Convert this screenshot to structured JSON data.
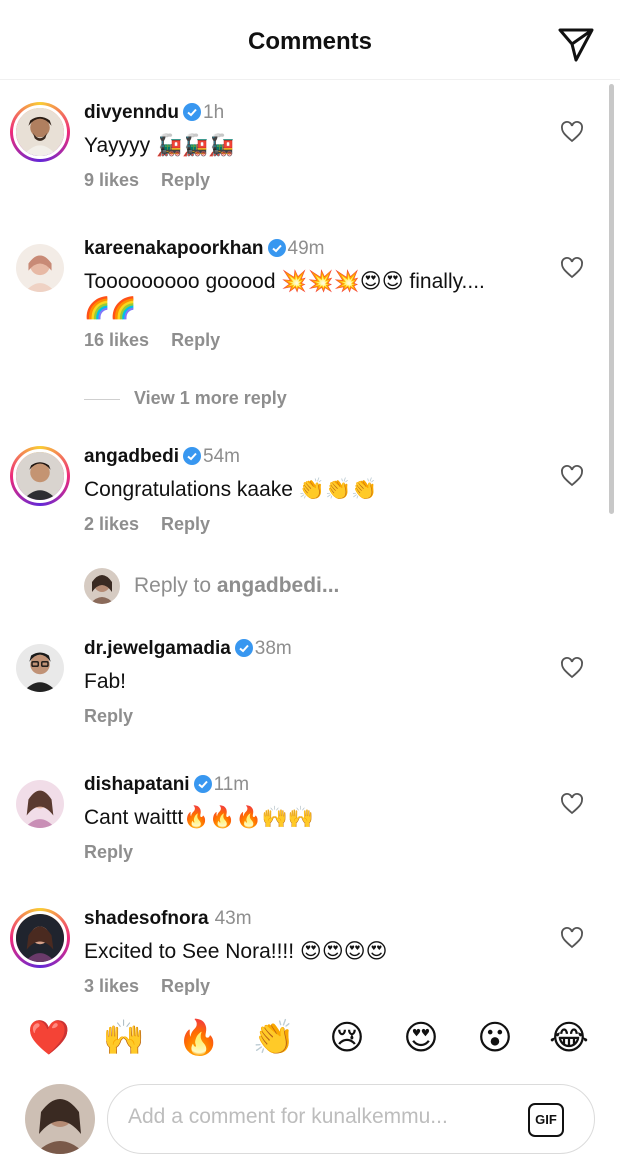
{
  "header": {
    "title": "Comments",
    "send_icon": "paper-plane-icon"
  },
  "comments": [
    {
      "username": "divyenndu",
      "time": "1h",
      "text": "Yayyyy 🚂🚂🚂",
      "likes": "9 likes",
      "reply": "Reply",
      "has_story_ring": true
    },
    {
      "username": "kareenakapoorkhan",
      "time": "49m",
      "text": "Tooooooooo gooood 💥💥💥😍😍 finally....🌈🌈",
      "likes": "16 likes",
      "reply": "Reply",
      "has_story_ring": false
    },
    {
      "username": "angadbedi",
      "time": "54m",
      "text": "Congratulations kaake 👏👏👏",
      "likes": "2 likes",
      "reply": "Reply",
      "has_story_ring": true
    },
    {
      "username": "dr.jewelgamadia",
      "time": "38m",
      "text": "Fab!",
      "likes": "",
      "reply": "Reply",
      "has_story_ring": false
    },
    {
      "username": "dishapatani",
      "time": "11m",
      "text": "Cant waittt🔥🔥🔥🙌🙌",
      "likes": "",
      "reply": "Reply",
      "has_story_ring": false
    },
    {
      "username": "shadesofnora",
      "time": "43m",
      "text": "Excited to See Nora!!!! 😍😍😍😍",
      "likes": "3 likes",
      "reply": "Reply",
      "has_story_ring": true
    }
  ],
  "view_more": "View 1 more reply",
  "reply_to": {
    "prefix": "Reply to ",
    "username": "angadbedi..."
  },
  "reactions": [
    "❤️",
    "🙌",
    "🔥",
    "👏",
    "😢",
    "😍",
    "😮",
    "😂"
  ],
  "composer": {
    "placeholder": "Add a comment for kunalkemmu...",
    "gif_label": "GIF"
  },
  "colors": {
    "verified": "#3897f0",
    "muted": "#8e8e8e",
    "text": "#111111"
  }
}
